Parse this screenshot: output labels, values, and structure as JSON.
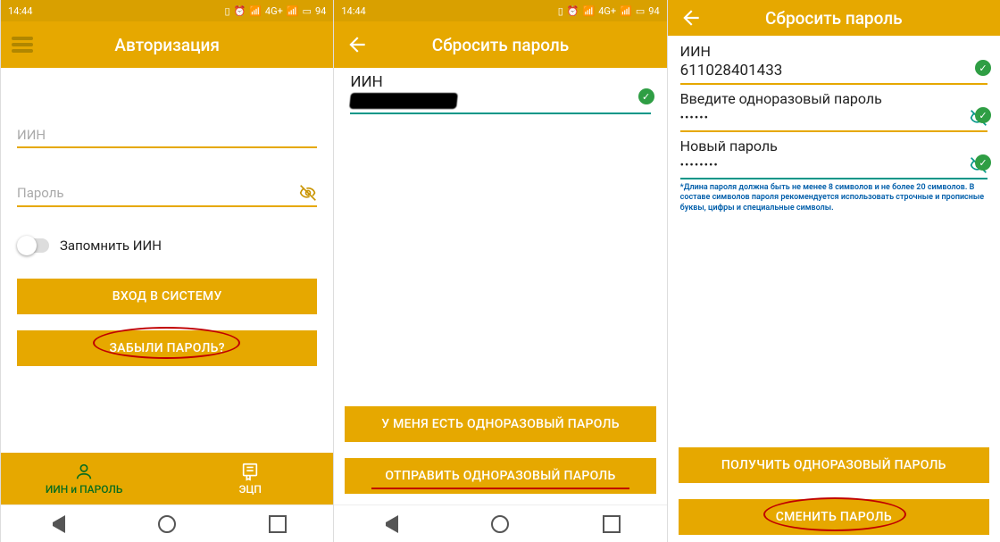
{
  "status": {
    "time": "14:44",
    "battery": "94",
    "net": "4G+"
  },
  "screen1": {
    "title": "Авторизация",
    "iin_placeholder": "ИИН",
    "pwd_placeholder": "Пароль",
    "remember": "Запомнить ИИН",
    "btn_login": "ВХОД В СИСТЕМУ",
    "btn_forgot": "ЗАБЫЛИ ПАРОЛЬ?",
    "tab1": "ИИН и ПАРОЛЬ",
    "tab2": "ЭЦП"
  },
  "screen2": {
    "title": "Сбросить пароль",
    "iin_label": "ИИН",
    "btn_have": "У МЕНЯ ЕСТЬ ОДНОРАЗОВЫЙ ПАРОЛЬ",
    "btn_send": "ОТПРАВИТЬ ОДНОРАЗОВЫЙ ПАРОЛЬ"
  },
  "screen3": {
    "title": "Сбросить пароль",
    "iin_label": "ИИН",
    "iin_value": "611028401433",
    "otp_label": "Введите одноразовый пароль",
    "otp_value": "••••••",
    "new_label": "Новый пароль",
    "new_value": "••••••••",
    "hint": "*Длина пароля должна быть не менее 8 символов и не более 20 символов. В составе символов пароля рекомендуется использовать строчные и прописные буквы, цифры и специальные символы.",
    "btn_get": "ПОЛУЧИТЬ ОДНОРАЗОВЫЙ ПАРОЛЬ",
    "btn_change": "СМЕНИТЬ ПАРОЛЬ"
  }
}
